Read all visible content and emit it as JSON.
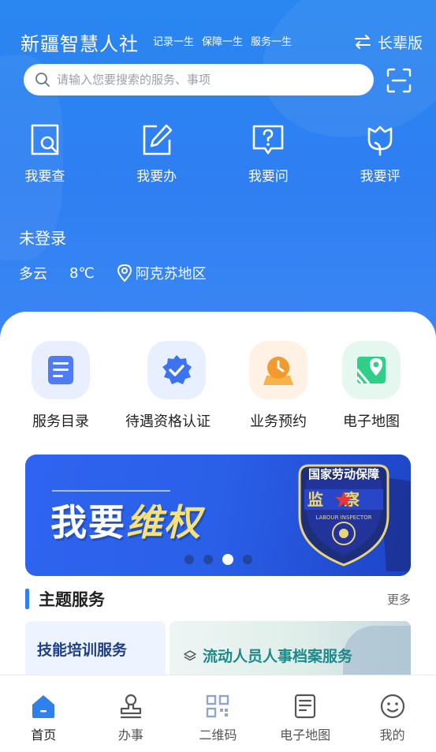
{
  "header": {
    "app_title": "新疆智慧人社",
    "slogans": [
      "记录一生",
      "保障一生",
      "服务一生"
    ],
    "mode_switch_label": "长辈版"
  },
  "search": {
    "placeholder": "请输入您要搜索的服务、事项"
  },
  "quick_actions": [
    {
      "label": "我要查",
      "icon": "search-doc-icon"
    },
    {
      "label": "我要办",
      "icon": "edit-icon"
    },
    {
      "label": "我要问",
      "icon": "question-icon"
    },
    {
      "label": "我要评",
      "icon": "tulip-icon"
    }
  ],
  "user": {
    "status": "未登录"
  },
  "weather": {
    "condition": "多云",
    "temperature": "8℃",
    "location": "阿克苏地区"
  },
  "services": [
    {
      "label": "服务目录",
      "icon": "catalog-icon",
      "color": "#4f7cf2"
    },
    {
      "label": "待遇资格认证",
      "icon": "verify-badge-icon",
      "color": "#3d73f0"
    },
    {
      "label": "业务预约",
      "icon": "clock-calendar-icon",
      "color": "#f29a2e"
    },
    {
      "label": "电子地图",
      "icon": "map-pin-icon",
      "color": "#2fcf8a"
    }
  ],
  "banner": {
    "title_part1": "我要",
    "title_part2": "维权",
    "badge_top": "国家劳动保障",
    "badge_main": "监察",
    "badge_sub": "LABOUR INSPECTOR",
    "carousel_count": 4,
    "carousel_active_index": 2
  },
  "theme_section": {
    "title": "主题服务",
    "more_label": "更多",
    "cards": [
      "技能培训服务",
      "流动人员人事档案服务"
    ]
  },
  "tabbar": [
    {
      "label": "首页",
      "icon": "home-icon",
      "active": true
    },
    {
      "label": "办事",
      "icon": "stamp-icon",
      "active": false
    },
    {
      "label": "二维码",
      "icon": "qrcode-icon",
      "active": false
    },
    {
      "label": "电子地图",
      "icon": "map-doc-icon",
      "active": false
    },
    {
      "label": "我的",
      "icon": "smile-face-icon",
      "active": false
    }
  ],
  "colors": {
    "primary": "#2f80ed",
    "banner_accent": "#f7e27a"
  }
}
